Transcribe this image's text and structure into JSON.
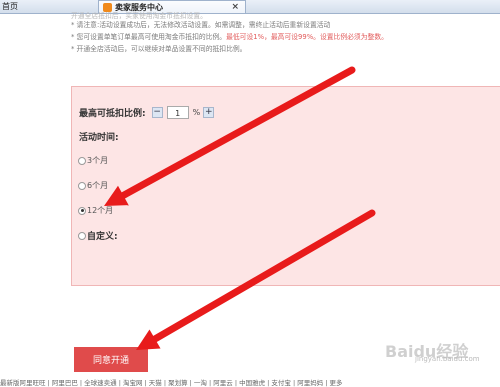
{
  "tabs": [
    {
      "label": "首页"
    },
    {
      "label": "卖家服务中心"
    }
  ],
  "notes": {
    "top_partial": "开通全店抵扣后，买家使用淘金币抵扣设置。",
    "line1": "* 请注意:活动设置成功后，无法修改活动设置。如需调整，需终止活动后重新设置活动",
    "line2_prefix": "* 您可设置单笔订单最高可使用淘金币抵扣的比例。",
    "line2_red": "最低可设1%，最高可设99%。设置比例必须为整数。",
    "line3": "* 开通全店活动后，可以继续对单品设置不同的抵扣比例。"
  },
  "form": {
    "max_ratio_label": "最高可抵扣比例:",
    "ratio_value": "1",
    "percent": "%",
    "duration_label": "活动时间:",
    "options": [
      {
        "label": "3个月",
        "checked": false
      },
      {
        "label": "6个月",
        "checked": false
      },
      {
        "label": "12个月",
        "checked": true
      },
      {
        "label": "自定义:",
        "checked": false
      }
    ],
    "submit_label": "同意开通"
  },
  "footer": "最新版阿里旺旺 | 阿里巴巴 | 全球速卖通 | 淘宝网 | 天猫 | 聚划算 | 一淘 | 阿里云 | 中国雅虎 | 支付宝 | 阿里妈妈 | 更多",
  "watermark": {
    "brand": "Baidu经验",
    "sub": "jingyan.baidu.com"
  },
  "arrow_color": "#e81b1b"
}
